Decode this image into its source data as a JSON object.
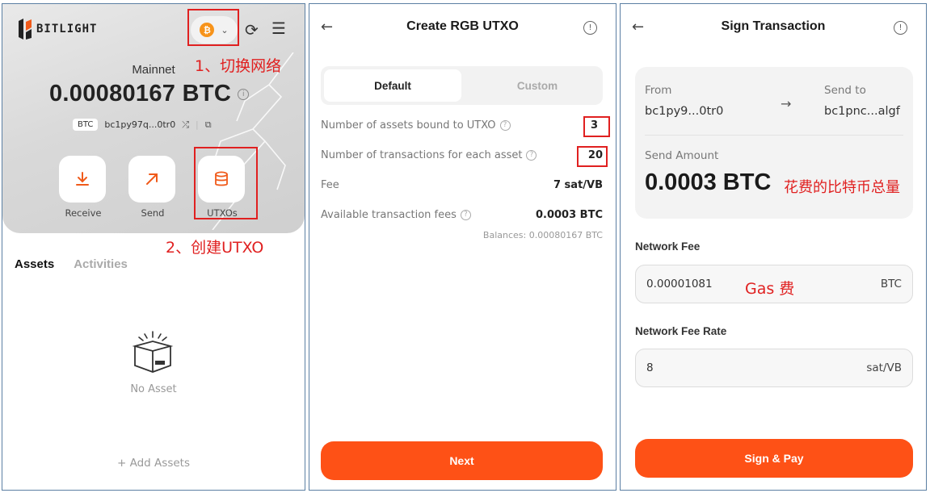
{
  "panel_wallet": {
    "logo_text": "BITLIGHT",
    "network_icon": "bitcoin-icon",
    "network_coin_glyph": "₿",
    "network_name": "Mainnet",
    "balance": "0.00080167 BTC",
    "asset_tag": "BTC",
    "address_short": "bc1py97q...0tr0",
    "actions": [
      {
        "label": "Receive",
        "icon": "download-icon"
      },
      {
        "label": "Send",
        "icon": "arrow-up-right-icon"
      },
      {
        "label": "UTXOs",
        "icon": "database-icon"
      }
    ],
    "annotation_switch_network": "1、切换网络",
    "annotation_create_utxo": "2、创建UTXO",
    "tabs": [
      "Assets",
      "Activities"
    ],
    "empty_text": "No Asset",
    "add_assets_label": "+ Add Assets"
  },
  "panel_create": {
    "title": "Create RGB UTXO",
    "segments": [
      "Default",
      "Custom"
    ],
    "rows": [
      {
        "label": "Number of assets bound to UTXO",
        "value": "3",
        "help": true
      },
      {
        "label": "Number of transactions for each asset",
        "value": "20",
        "help": true
      },
      {
        "label": "Fee",
        "value": "7 sat/VB",
        "help": false
      },
      {
        "label": "Available transaction fees",
        "value": "0.0003 BTC",
        "help": true
      }
    ],
    "balances_note": "Balances: 0.00080167 BTC",
    "next_label": "Next"
  },
  "panel_sign": {
    "title": "Sign Transaction",
    "from_label": "From",
    "from_value": "bc1py9...0tr0",
    "to_label": "Send to",
    "to_value": "bc1pnc...algf",
    "send_amount_label": "Send Amount",
    "send_amount": "0.0003 BTC",
    "annotation_amount": "花费的比特币总量",
    "network_fee_label": "Network Fee",
    "network_fee_value": "0.00001081",
    "network_fee_unit": "BTC",
    "annotation_gas": "Gas 费",
    "fee_rate_label": "Network Fee Rate",
    "fee_rate_value": "8",
    "fee_rate_unit": "sat/VB",
    "sign_label": "Sign & Pay"
  },
  "colors": {
    "accent": "#fe5116",
    "annotation_red": "#e02020",
    "bitcoin": "#f7931a"
  }
}
